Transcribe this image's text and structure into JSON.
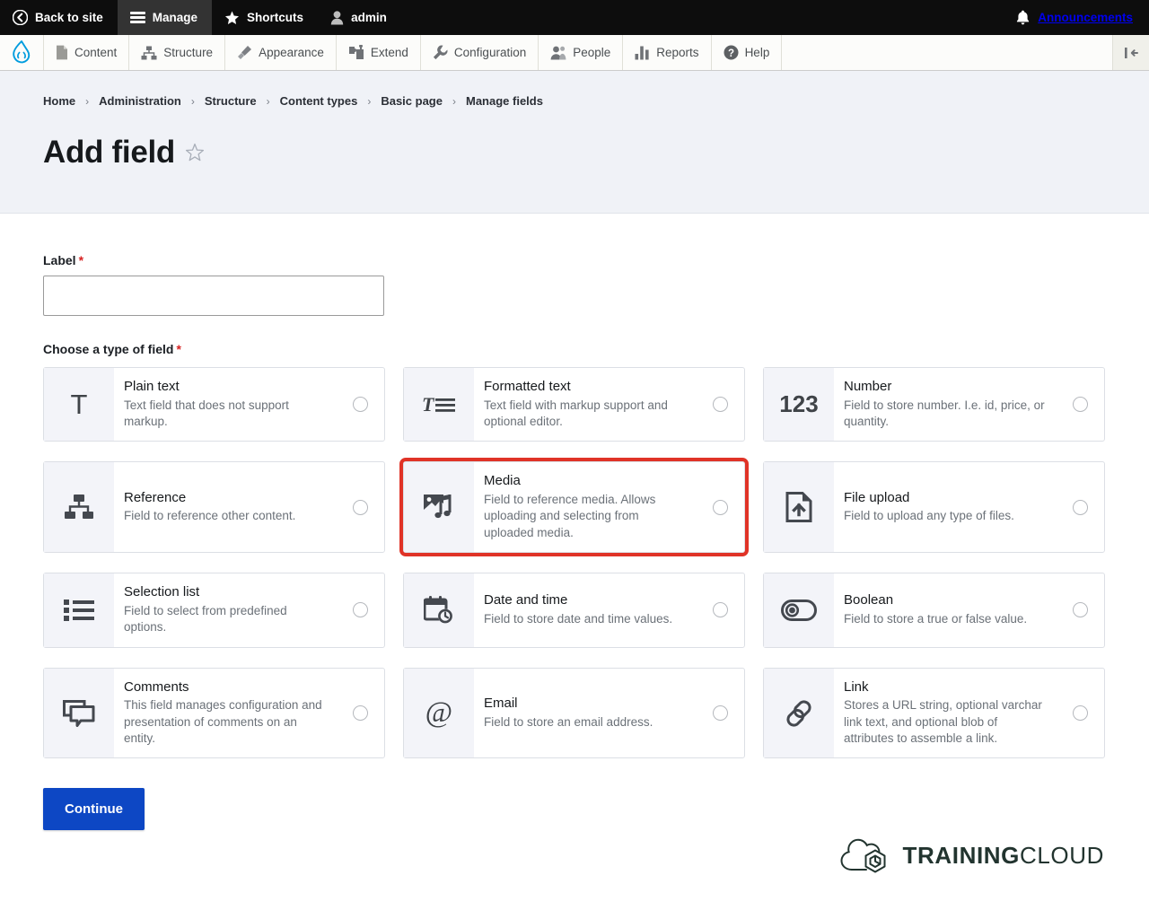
{
  "toolbar": {
    "back_to_site": "Back to site",
    "manage": "Manage",
    "shortcuts": "Shortcuts",
    "account": "admin",
    "announcements": "Announcements"
  },
  "admin_menu": {
    "items": [
      {
        "label": "Content",
        "icon": "document-icon"
      },
      {
        "label": "Structure",
        "icon": "sitemap-icon"
      },
      {
        "label": "Appearance",
        "icon": "paintbrush-icon"
      },
      {
        "label": "Extend",
        "icon": "puzzle-icon"
      },
      {
        "label": "Configuration",
        "icon": "wrench-icon"
      },
      {
        "label": "People",
        "icon": "people-icon"
      },
      {
        "label": "Reports",
        "icon": "bar-chart-icon"
      },
      {
        "label": "Help",
        "icon": "question-circle-icon"
      }
    ]
  },
  "breadcrumb": {
    "items": [
      "Home",
      "Administration",
      "Structure",
      "Content types",
      "Basic page",
      "Manage fields"
    ],
    "separator": "›"
  },
  "page": {
    "title": "Add field"
  },
  "form": {
    "label_field": {
      "label": "Label",
      "required_marker": "*",
      "value": "",
      "placeholder": ""
    },
    "field_type_section": {
      "label": "Choose a type of field",
      "required_marker": "*"
    },
    "continue_label": "Continue"
  },
  "field_types": [
    {
      "title": "Plain text",
      "description": "Text field that does not support markup.",
      "icon": "plain-text-icon",
      "glyph": "T",
      "selected": false,
      "highlighted": false
    },
    {
      "title": "Formatted text",
      "description": "Text field with markup support and optional editor.",
      "icon": "formatted-text-icon",
      "glyph": "",
      "selected": false,
      "highlighted": false
    },
    {
      "title": "Number",
      "description": "Field to store number. I.e. id, price, or quantity.",
      "icon": "number-icon",
      "glyph": "123",
      "selected": false,
      "highlighted": false
    },
    {
      "title": "Reference",
      "description": "Field to reference other content.",
      "icon": "reference-icon",
      "glyph": "",
      "selected": false,
      "highlighted": false
    },
    {
      "title": "Media",
      "description": "Field to reference media. Allows uploading and selecting from uploaded media.",
      "icon": "media-icon",
      "glyph": "",
      "selected": false,
      "highlighted": true
    },
    {
      "title": "File upload",
      "description": "Field to upload any type of files.",
      "icon": "file-upload-icon",
      "glyph": "",
      "selected": false,
      "highlighted": false
    },
    {
      "title": "Selection list",
      "description": "Field to select from predefined options.",
      "icon": "selection-list-icon",
      "glyph": "",
      "selected": false,
      "highlighted": false
    },
    {
      "title": "Date and time",
      "description": "Field to store date and time values.",
      "icon": "calendar-clock-icon",
      "glyph": "",
      "selected": false,
      "highlighted": false
    },
    {
      "title": "Boolean",
      "description": "Field to store a true or false value.",
      "icon": "toggle-icon",
      "glyph": "",
      "selected": false,
      "highlighted": false
    },
    {
      "title": "Comments",
      "description": "This field manages configuration and presentation of comments on an entity.",
      "icon": "comments-icon",
      "glyph": "",
      "selected": false,
      "highlighted": false
    },
    {
      "title": "Email",
      "description": "Field to store an email address.",
      "icon": "email-icon",
      "glyph": "@",
      "selected": false,
      "highlighted": false
    },
    {
      "title": "Link",
      "description": "Stores a URL string, optional varchar link text, and optional blob of attributes to assemble a link.",
      "icon": "link-icon",
      "glyph": "",
      "selected": false,
      "highlighted": false
    }
  ],
  "footer": {
    "logo_bold": "TRAINING",
    "logo_light": "CLOUD"
  },
  "colors": {
    "accent_blue": "#0d47c4",
    "highlight_red": "#e03327",
    "required_red": "#d72222",
    "drupal_blue": "#009cde",
    "header_bg": "#f0f2f7",
    "icon_tile_bg": "#f3f4f9"
  }
}
